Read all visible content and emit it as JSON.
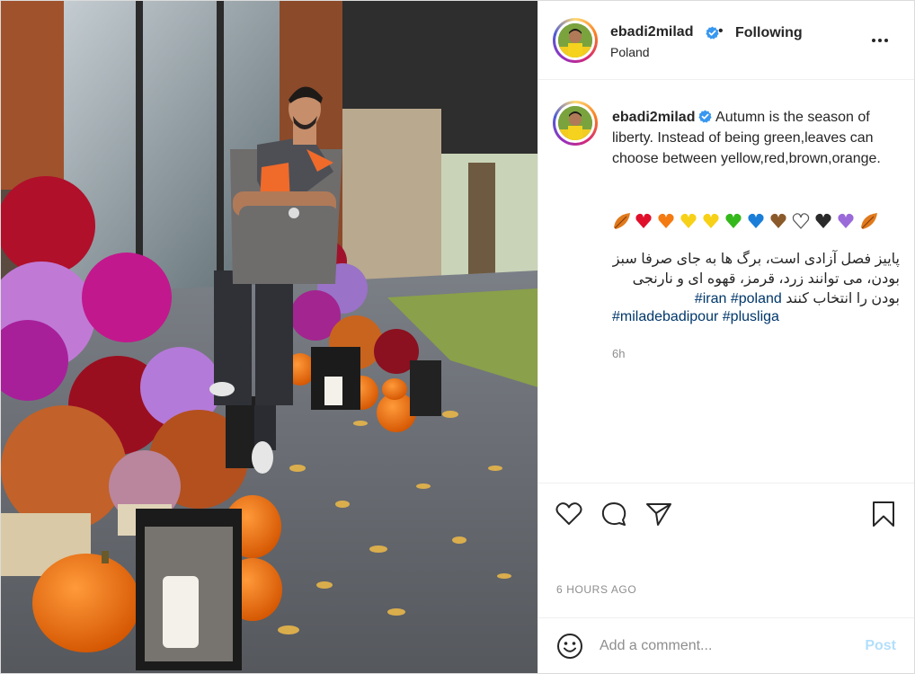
{
  "post": {
    "image_alt": "Man standing among autumn flowers and pumpkins outside a hotel",
    "author": {
      "username": "ebadi2milad",
      "verified": true,
      "follow_separator": "•",
      "follow_status": "Following",
      "location": "Poland"
    },
    "caption": {
      "text_en": "Autumn is the season of liberty. Instead of being green,leaves can choose between yellow,red,brown,orange.",
      "emojis": [
        "fallen-leaf",
        "red-heart",
        "orange-heart",
        "yellow-heart",
        "yellow-heart",
        "green-heart",
        "blue-heart",
        "brown-heart",
        "white-heart",
        "black-heart",
        "purple-heart",
        "fallen-leaf"
      ],
      "text_fa": "پاییز فصل آزادی است، برگ ها به جای صرفا سبز بودن، می توانند زرد، قرمز، قهوه ای و نارنجی بودن را انتخاب کنند",
      "tag_poland": "#poland",
      "tag_iran": "#iran",
      "tag_miladebadipour": "#miladebadipour",
      "tag_plusliga": "#plusliga",
      "relative_time": "6h"
    },
    "posted_time": "6 HOURS AGO",
    "comment": {
      "placeholder": "Add a comment...",
      "post_label": "Post"
    }
  },
  "icons": {
    "like": "heart-outline-icon",
    "comment": "speech-bubble-icon",
    "share": "paper-plane-icon",
    "save": "bookmark-icon",
    "emoji": "smiley-face-icon",
    "more": "three-dots-icon",
    "verified": "verified-badge-icon"
  },
  "colors": {
    "link": "#00376b",
    "muted": "#8e8e8e",
    "verified": "#3897f0",
    "post_button_disabled": "#b2dffc"
  }
}
